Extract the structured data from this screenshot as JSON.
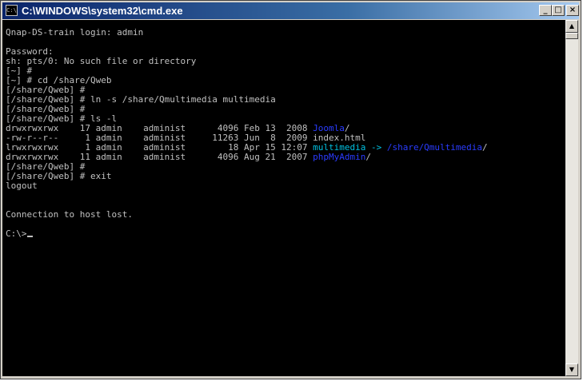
{
  "window": {
    "title": "C:\\WINDOWS\\system32\\cmd.exe",
    "app_icon": "C:\\",
    "buttons": {
      "minimize": "_",
      "maximize": "□",
      "close": "×"
    }
  },
  "scrollbar": {
    "up": "▲",
    "down": "▼"
  },
  "console": {
    "lines": [
      [
        {
          "t": "Qnap-DS-train login: admin"
        }
      ],
      [
        {
          "t": ""
        }
      ],
      [
        {
          "t": "Password:"
        }
      ],
      [
        {
          "t": "sh: pts/0: No such file or directory"
        }
      ],
      [
        {
          "t": "[~] #"
        }
      ],
      [
        {
          "t": "[~] # cd /share/Qweb"
        }
      ],
      [
        {
          "t": "[/share/Qweb] #"
        }
      ],
      [
        {
          "t": "[/share/Qweb] # ln -s /share/Qmultimedia multimedia"
        }
      ],
      [
        {
          "t": "[/share/Qweb] #"
        }
      ],
      [
        {
          "t": "[/share/Qweb] # ls -l"
        }
      ],
      [
        {
          "t": "drwxrwxrwx    17 admin    administ      4096 Feb 13  2008 "
        },
        {
          "t": "Joomla",
          "c": "blue"
        },
        {
          "t": "/"
        }
      ],
      [
        {
          "t": "-rw-r--r--     1 admin    administ     11263 Jun  8  2009 index.html"
        }
      ],
      [
        {
          "t": "lrwxrwxrwx     1 admin    administ        18 Apr 15 12:07 "
        },
        {
          "t": "multimedia -> ",
          "c": "cyan"
        },
        {
          "t": "/share/Qmultimedia",
          "c": "blue"
        },
        {
          "t": "/"
        }
      ],
      [
        {
          "t": "drwxrwxrwx    11 admin    administ      4096 Aug 21  2007 "
        },
        {
          "t": "phpMyAdmin",
          "c": "blue"
        },
        {
          "t": "/"
        }
      ],
      [
        {
          "t": "[/share/Qweb] #"
        }
      ],
      [
        {
          "t": "[/share/Qweb] # exit"
        }
      ],
      [
        {
          "t": "logout"
        }
      ],
      [
        {
          "t": ""
        }
      ],
      [
        {
          "t": ""
        }
      ],
      [
        {
          "t": "Connection to host lost."
        }
      ],
      [
        {
          "t": ""
        }
      ],
      [
        {
          "t": "C:\\>"
        }
      ]
    ]
  }
}
